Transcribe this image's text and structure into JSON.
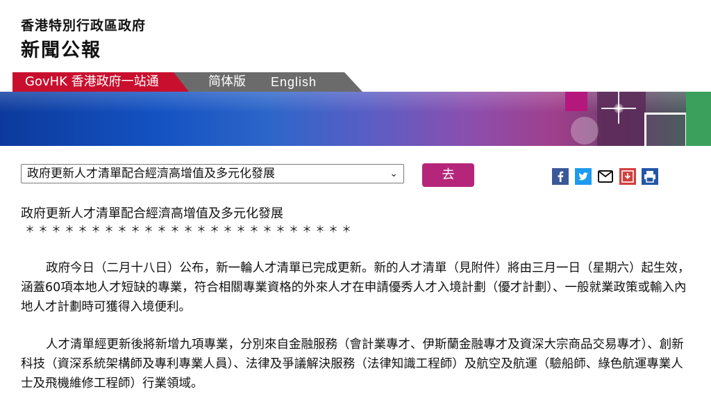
{
  "header": {
    "gov_name": "香港特別行政區政府",
    "site_title": "新聞公報"
  },
  "nav": {
    "govhk": "GovHK 香港政府一站通",
    "simplified": "简体版",
    "english": "English"
  },
  "toolbar": {
    "select_value": "政府更新人才清單配合經濟高增值及多元化發展",
    "go_label": "去",
    "share_icons": [
      "facebook-icon",
      "twitter-icon",
      "email-icon",
      "download-icon",
      "print-icon"
    ]
  },
  "article": {
    "title": "政府更新人才清單配合經濟高增值及多元化發展",
    "separator": "＊＊＊＊＊＊＊＊＊＊＊＊＊＊＊＊＊＊＊＊＊＊＊＊＊",
    "paragraphs": [
      "政府今日（二月十八日）公布，新一輪人才清單已完成更新。新的人才清單（見附件）將由三月一日（星期六）起生效，涵蓋60項本地人才短缺的專業，符合相關專業資格的外來人才在申請優秀人才入境計劃（優才計劃）、一般就業政策或輸入內地人才計劃時可獲得入境便利。",
      "人才清單經更新後將新增九項專業，分別來自金融服務（會計業專才、伊斯蘭金融專才及資深大宗商品交易專才）、創新科技（資深系統架構師及專利專業人員）、法律及爭議解決服務（法律知識工程師）及航空及航運（驗船師、綠色航運專業人士及飛機維修工程師）行業領域。"
    ]
  },
  "colors": {
    "gov_red": "#c8102e",
    "nav_grey": "#6b6b6b",
    "go_button": "#b5267a",
    "facebook": "#3b5998",
    "twitter": "#1d9bf0"
  }
}
